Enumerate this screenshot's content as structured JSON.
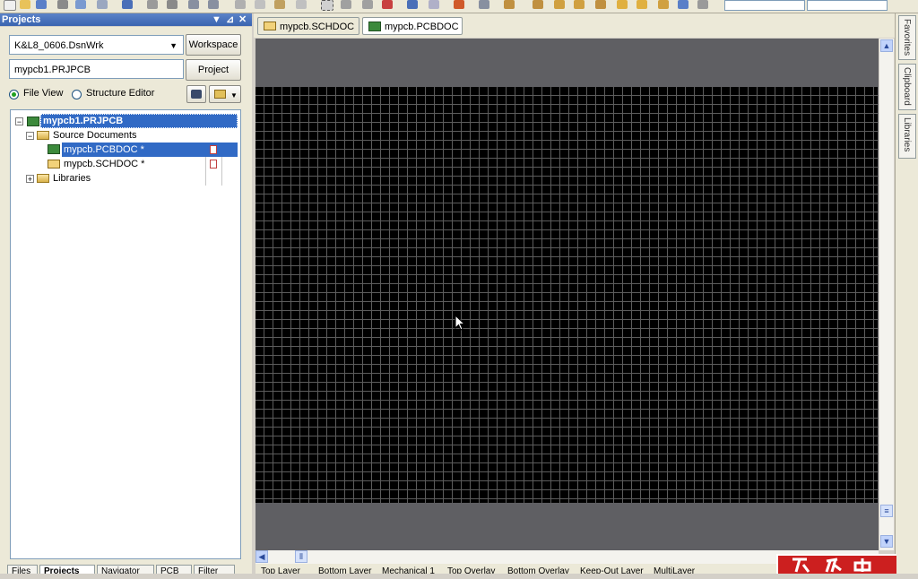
{
  "panel": {
    "title": "Projects",
    "workspace_value": "K&L8_0606.DsnWrk",
    "workspace_button": "Workspace",
    "project_value": "mypcb1.PRJPCB",
    "project_button": "Project",
    "view_mode": {
      "file_view_label": "File View",
      "structure_editor_label": "Structure Editor",
      "selected": "File View"
    }
  },
  "tree": {
    "project": "mypcb1.PRJPCB",
    "source_folder": "Source Documents",
    "documents": [
      "mypcb.PCBDOC *",
      "mypcb.SCHDOC *"
    ],
    "libraries_folder": "Libraries"
  },
  "bottom_tabs": [
    "Files",
    "Projects",
    "Navigator",
    "PCB",
    "Filter"
  ],
  "doc_tabs": [
    "mypcb.SCHDOC *",
    "mypcb.PCBDOC *"
  ],
  "active_doc_tab": "mypcb.PCBDOC *",
  "layer_tabs": [
    "Top Layer",
    "Bottom Layer",
    "Mechanical 1",
    "Top Overlay",
    "Bottom Overlay",
    "Keep-Out Layer",
    "MultiLayer"
  ],
  "side_tabs": [
    "Favorites",
    "Clipboard",
    "Libraries"
  ],
  "icons": {
    "toolbar": [
      "new-icon",
      "open-icon",
      "save-icon",
      "print-icon",
      "preview-icon",
      "zoom-icon",
      "cut-icon",
      "copy-icon",
      "paste-icon",
      "select-icon",
      "move-icon",
      "undo-icon",
      "redo-icon",
      "wire-icon",
      "text-icon"
    ],
    "panel_controls": [
      "dropdown-arrow-icon",
      "pin-icon",
      "close-icon"
    ]
  },
  "colors": {
    "panel_title_bg": "#3a64b0",
    "tree_selection": "#316ac5",
    "board_bg": "#000000",
    "canvas_bg": "#5f5f63",
    "grid_line": "#5c5c5c"
  }
}
